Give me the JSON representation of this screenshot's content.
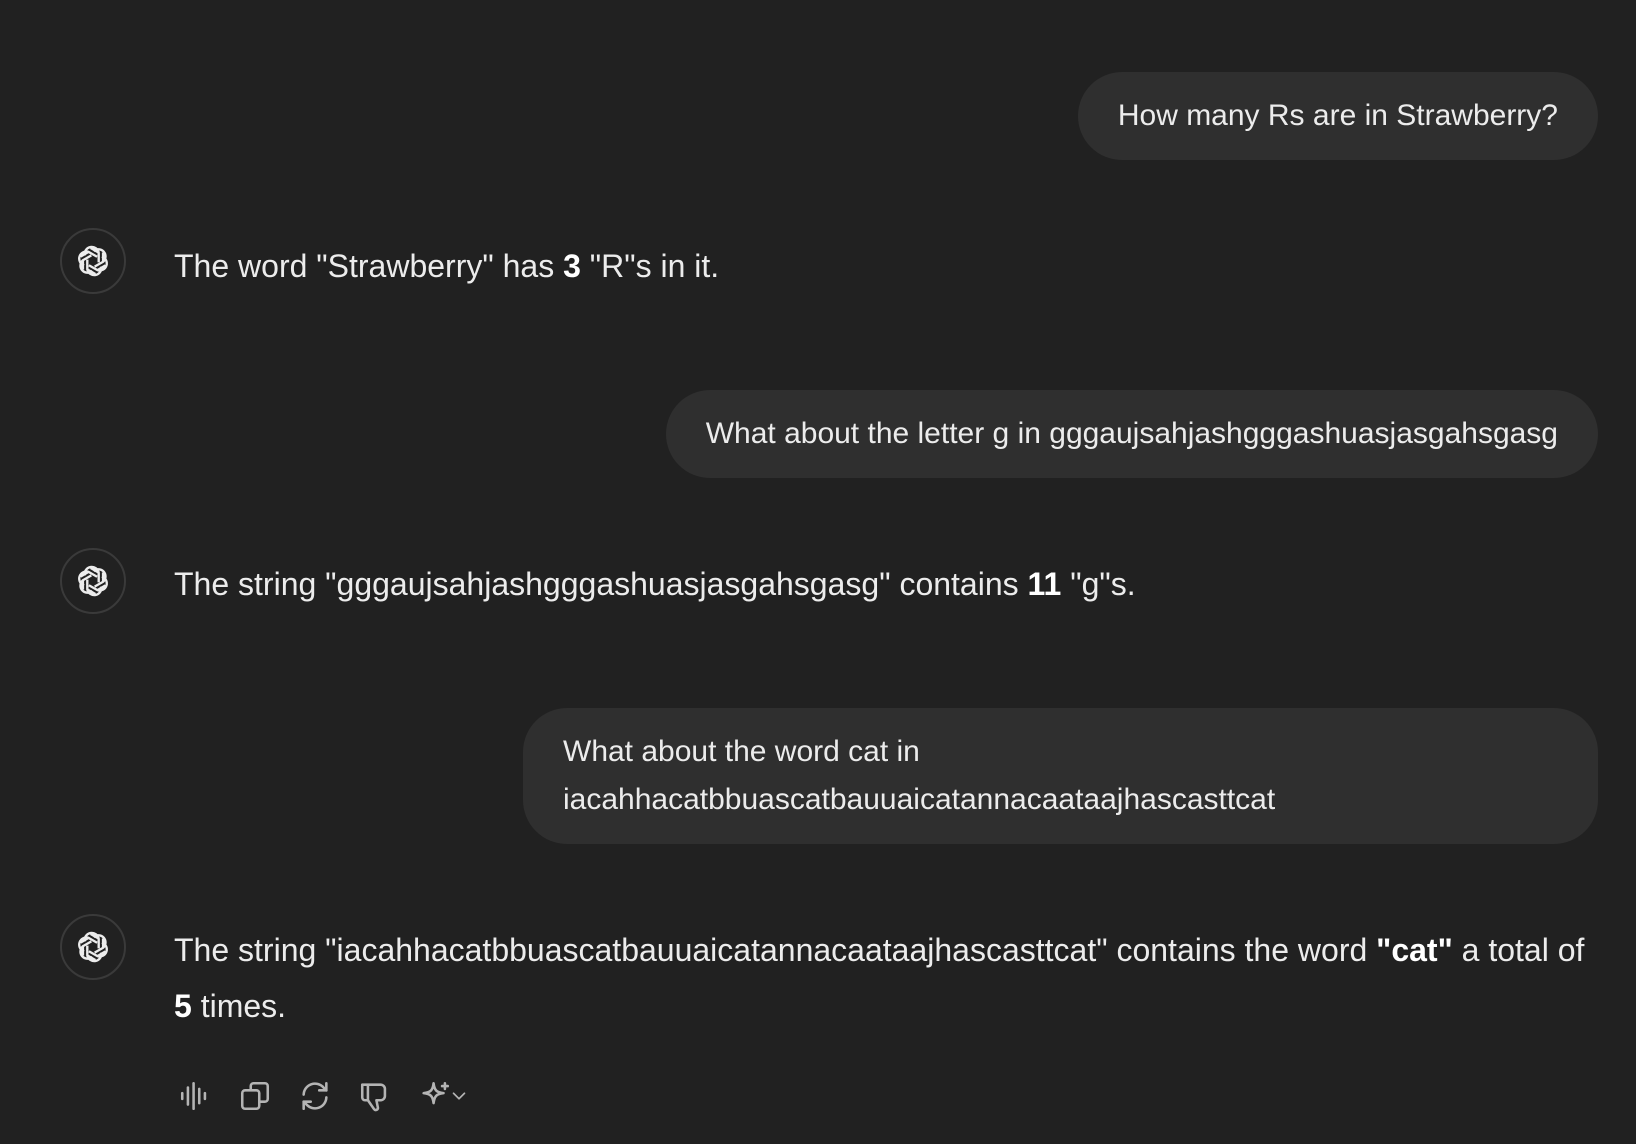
{
  "conversation": {
    "user_messages": [
      "How many Rs are in Strawberry?",
      "What about the letter g in gggaujsahjashgggashuasjasgahsgasg",
      "What about the word cat in iacahhacatbbuascatbauuaicatannacaataajhascasttcat"
    ],
    "assistant_messages": [
      {
        "pre": "The word \"Strawberry\" has ",
        "bold": "3",
        "post": " \"R\"s in it."
      },
      {
        "pre": "The string \"gggaujsahjashgggashuasjasgahsgasg\" contains ",
        "bold": "11",
        "post": " \"g\"s."
      },
      {
        "pre": "The string \"iacahhacatbbuascatbauuaicatannacaataajhascasttcat\" contains the word ",
        "bold": "\"cat\"",
        "mid": " a total of ",
        "bold2": "5",
        "post": " times."
      }
    ],
    "assistant_avatar_icon": "openai-logo-icon"
  },
  "action_bar": {
    "icons": [
      "read-aloud-icon",
      "copy-icon",
      "regenerate-icon",
      "thumbs-down-icon",
      "sparkle-model-icon",
      "chevron-down-icon"
    ]
  },
  "colors": {
    "background": "#212121",
    "user_bubble": "#2f2f2f",
    "text": "#ececec",
    "icon": "#b4b4b4"
  }
}
